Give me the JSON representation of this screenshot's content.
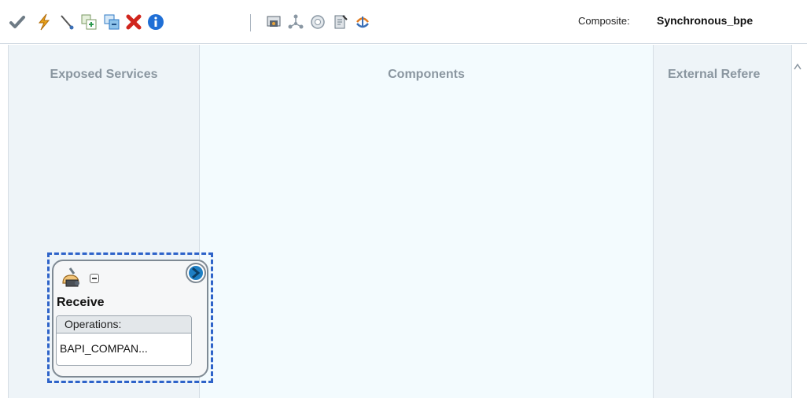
{
  "toolbar": {
    "buttons": [
      {
        "name": "validate-icon",
        "color": "#6e7b85"
      },
      {
        "name": "lightning-icon",
        "color": "#e8a21a"
      },
      {
        "name": "wire-icon",
        "color": "#3b6fb6"
      },
      {
        "name": "add-component-icon",
        "color": "#2e9a4f"
      },
      {
        "name": "copy-component-icon",
        "color": "#2e7ac6"
      },
      {
        "name": "delete-icon",
        "color": "#d0251d"
      },
      {
        "name": "info-icon",
        "color": "#1f6fd6"
      },
      {
        "name": "deploy-icon",
        "color": "#5a6470"
      },
      {
        "name": "layout-icon",
        "color": "#8a97a3"
      },
      {
        "name": "database-icon",
        "color": "#8a97a3"
      },
      {
        "name": "edit-document-icon",
        "color": "#6a7884"
      },
      {
        "name": "test-icon",
        "color": "#e07a1f"
      }
    ],
    "composite_label": "Composite:",
    "composite_name": "Synchronous_bpe"
  },
  "lanes": {
    "exposed": {
      "title": "Exposed Services"
    },
    "components": {
      "title": "Components"
    },
    "external": {
      "title": "External Refere"
    }
  },
  "service": {
    "title": "Receive",
    "operations_label": "Operations:",
    "operation": "BAPI_COMPAN..."
  },
  "colors": {
    "selection": "#2e63c9",
    "lane_bg": "#eef4f8",
    "components_bg": "#f3fbfe"
  }
}
